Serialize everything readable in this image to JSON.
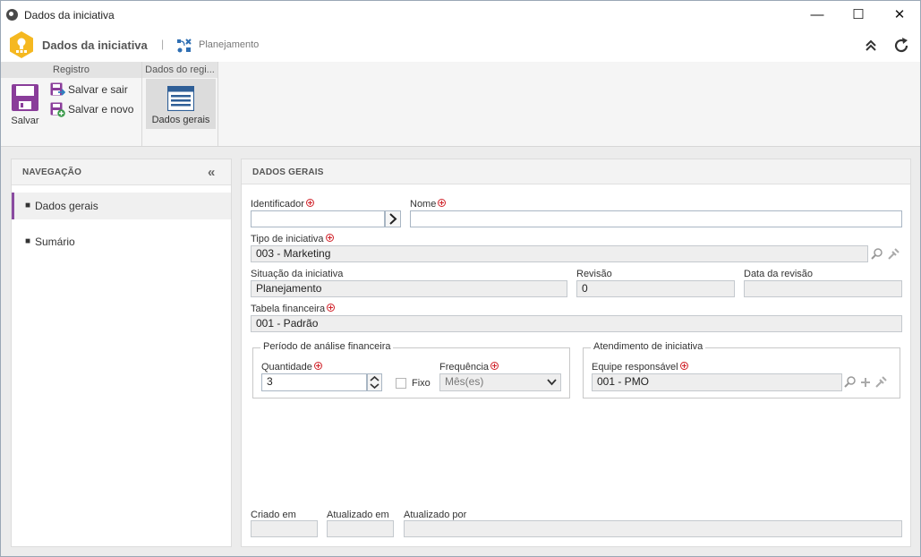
{
  "window": {
    "title": "Dados da iniciativa",
    "minimize": "—",
    "maximize": "☐",
    "close": "✕"
  },
  "header": {
    "title": "Dados da iniciativa",
    "separator": "|",
    "status": "Planejamento",
    "logo_color": "#f5b820"
  },
  "ribbon": {
    "groups": [
      {
        "label": "Registro"
      },
      {
        "label": "Dados do regi..."
      }
    ],
    "save_label": "Salvar",
    "save_exit_label": "Salvar e sair",
    "save_new_label": "Salvar e novo",
    "general_data_label": "Dados gerais"
  },
  "navigation": {
    "title": "NAVEGAÇÃO",
    "collapse": "«",
    "items": [
      {
        "label": "Dados gerais",
        "active": true
      },
      {
        "label": "Sumário",
        "active": false
      }
    ],
    "accent_color": "#8a4ba0"
  },
  "main": {
    "title": "DADOS GERAIS",
    "identificador": {
      "label": "Identificador",
      "value": ""
    },
    "nome": {
      "label": "Nome",
      "value": ""
    },
    "tipo": {
      "label": "Tipo de iniciativa",
      "value": "003 - Marketing"
    },
    "situacao": {
      "label": "Situação da iniciativa",
      "value": "Planejamento"
    },
    "revisao": {
      "label": "Revisão",
      "value": "0"
    },
    "data_revisao": {
      "label": "Data da revisão",
      "value": ""
    },
    "tabela": {
      "label": "Tabela financeira",
      "value": "001 - Padrão"
    },
    "periodo": {
      "legend": "Período de análise financeira",
      "quantidade": {
        "label": "Quantidade",
        "value": "3"
      },
      "fixo": {
        "label": "Fixo",
        "checked": false
      },
      "frequencia": {
        "label": "Frequência",
        "value": "Mês(es)"
      }
    },
    "atendimento": {
      "legend": "Atendimento de iniciativa",
      "equipe": {
        "label": "Equipe responsável",
        "value": "001 - PMO"
      }
    },
    "criado_em": {
      "label": "Criado em",
      "value": ""
    },
    "atualizado_em": {
      "label": "Atualizado em",
      "value": ""
    },
    "atualizado_por": {
      "label": "Atualizado por",
      "value": ""
    },
    "required_color": "#d0222a"
  }
}
